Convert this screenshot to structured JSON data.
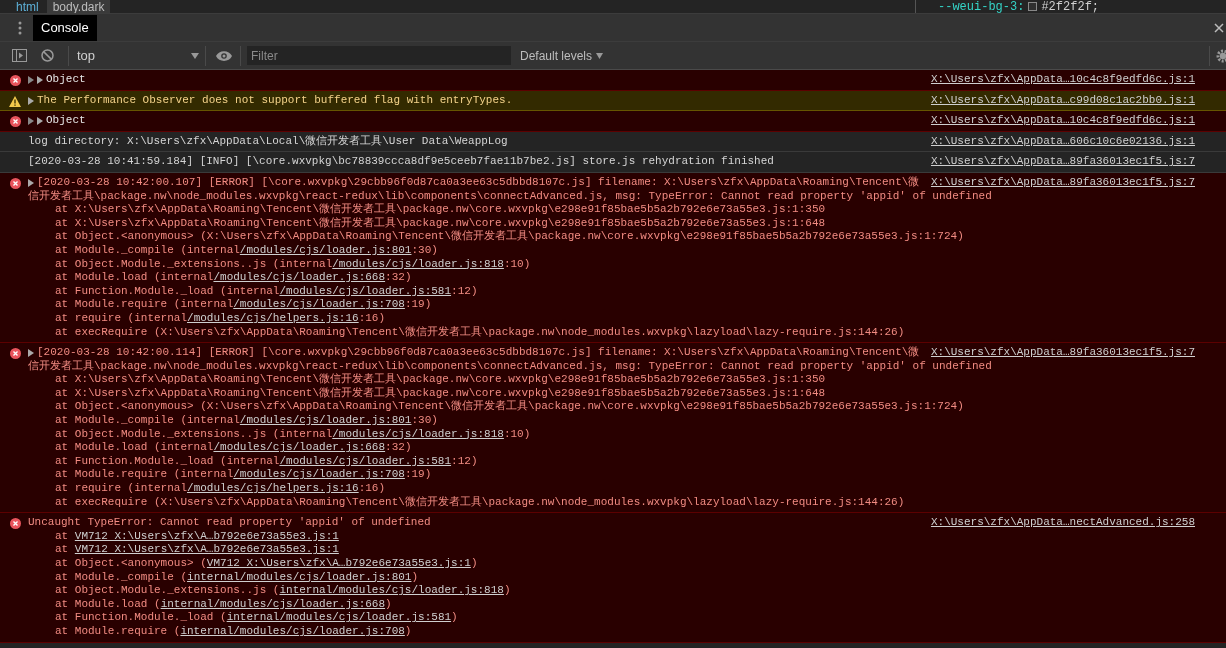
{
  "breadcrumb": [
    {
      "label": "html",
      "selected": false
    },
    {
      "label": "body.dark",
      "selected": true
    }
  ],
  "styles_pane": {
    "property": "--weui-bg-3:",
    "value": "#2f2f2f;"
  },
  "tabs": [
    {
      "label": "Console",
      "selected": true
    }
  ],
  "toolbar": {
    "context": "top",
    "filter_placeholder": "Filter",
    "levels": "Default levels"
  },
  "rows": [
    {
      "kind": "error",
      "grouped": true,
      "expandable": true,
      "message": "Object",
      "source": "X:\\Users\\zfx\\AppData…10c4c8f9edfd6c.js:1"
    },
    {
      "kind": "warning",
      "grouped": false,
      "expandable": true,
      "message": "The Performance Observer does not support buffered flag with entryTypes.",
      "source": "X:\\Users\\zfx\\AppData…c99d08c1ac2bb0.js:1"
    },
    {
      "kind": "error",
      "grouped": true,
      "expandable": true,
      "message": "Object",
      "source": "X:\\Users\\zfx\\AppData…10c4c8f9edfd6c.js:1"
    },
    {
      "kind": "info",
      "grouped": false,
      "expandable": false,
      "message": "log directory: X:\\Users\\zfx\\AppData\\Local\\微信开发者工具\\User Data\\WeappLog",
      "source": "X:\\Users\\zfx\\AppData…606c10c6e02136.js:1"
    },
    {
      "kind": "info",
      "grouped": false,
      "expandable": false,
      "message": "[2020-03-28 10:41:59.184] [INFO] [\\core.wxvpkg\\bc78839ccca8df9e5ceeb7fae11b7be2.js] store.js rehydration finished",
      "source": "X:\\Users\\zfx\\AppData…89fa36013ec1f5.js:7"
    },
    {
      "kind": "error",
      "grouped": false,
      "expandable": true,
      "message": "[2020-03-28 10:42:00.107] [ERROR] [\\core.wxvpkg\\29cbb96f0d87ca0a3ee63c5dbbd8107c.js] filename: X:\\Users\\zfx\\AppData\\Roaming\\Tencent\\微",
      "message_continued": "信开发者工具\\package.nw\\node_modules.wxvpkg\\react-redux\\lib\\components\\connectAdvanced.js, msg: TypeError: Cannot read property 'appid' of undefined",
      "source": "X:\\Users\\zfx\\AppData…89fa36013ec1f5.js:7",
      "stack": [
        [
          "at X:\\Users\\zfx\\AppData\\Roaming\\Tencent\\微信开发者工具\\package.nw\\core.wxvpkg\\e298e91f85bae5b5a2b792e6e73a55e3.js:1:350"
        ],
        [
          "at X:\\Users\\zfx\\AppData\\Roaming\\Tencent\\微信开发者工具\\package.nw\\core.wxvpkg\\e298e91f85bae5b5a2b792e6e73a55e3.js:1:648"
        ],
        [
          "at Object.<anonymous> (X:\\Users\\zfx\\AppData\\Roaming\\Tencent\\微信开发者工具\\package.nw\\core.wxvpkg\\e298e91f85bae5b5a2b792e6e73a55e3.js:1:724)"
        ],
        [
          "at Module._compile (internal",
          "/modules/cjs/loader.js:801",
          ":30)"
        ],
        [
          "at Object.Module._extensions..js (internal",
          "/modules/cjs/loader.js:818",
          ":10)"
        ],
        [
          "at Module.load (internal",
          "/modules/cjs/loader.js:668",
          ":32)"
        ],
        [
          "at Function.Module._load (internal",
          "/modules/cjs/loader.js:581",
          ":12)"
        ],
        [
          "at Module.require (internal",
          "/modules/cjs/loader.js:708",
          ":19)"
        ],
        [
          "at require (internal",
          "/modules/cjs/helpers.js:16",
          ":16)"
        ],
        [
          "at execRequire (X:\\Users\\zfx\\AppData\\Roaming\\Tencent\\微信开发者工具\\package.nw\\node_modules.wxvpkg\\lazyload\\lazy-require.js:144:26)"
        ]
      ]
    },
    {
      "kind": "error",
      "grouped": false,
      "expandable": true,
      "message": "[2020-03-28 10:42:00.114] [ERROR] [\\core.wxvpkg\\29cbb96f0d87ca0a3ee63c5dbbd8107c.js] filename: X:\\Users\\zfx\\AppData\\Roaming\\Tencent\\微",
      "message_continued": "信开发者工具\\package.nw\\node_modules.wxvpkg\\react-redux\\lib\\components\\connectAdvanced.js, msg: TypeError: Cannot read property 'appid' of undefined",
      "source": "X:\\Users\\zfx\\AppData…89fa36013ec1f5.js:7",
      "stack": [
        [
          "at X:\\Users\\zfx\\AppData\\Roaming\\Tencent\\微信开发者工具\\package.nw\\core.wxvpkg\\e298e91f85bae5b5a2b792e6e73a55e3.js:1:350"
        ],
        [
          "at X:\\Users\\zfx\\AppData\\Roaming\\Tencent\\微信开发者工具\\package.nw\\core.wxvpkg\\e298e91f85bae5b5a2b792e6e73a55e3.js:1:648"
        ],
        [
          "at Object.<anonymous> (X:\\Users\\zfx\\AppData\\Roaming\\Tencent\\微信开发者工具\\package.nw\\core.wxvpkg\\e298e91f85bae5b5a2b792e6e73a55e3.js:1:724)"
        ],
        [
          "at Module._compile (internal",
          "/modules/cjs/loader.js:801",
          ":30)"
        ],
        [
          "at Object.Module._extensions..js (internal",
          "/modules/cjs/loader.js:818",
          ":10)"
        ],
        [
          "at Module.load (internal",
          "/modules/cjs/loader.js:668",
          ":32)"
        ],
        [
          "at Function.Module._load (internal",
          "/modules/cjs/loader.js:581",
          ":12)"
        ],
        [
          "at Module.require (internal",
          "/modules/cjs/loader.js:708",
          ":19)"
        ],
        [
          "at require (internal",
          "/modules/cjs/helpers.js:16",
          ":16)"
        ],
        [
          "at execRequire (X:\\Users\\zfx\\AppData\\Roaming\\Tencent\\微信开发者工具\\package.nw\\node_modules.wxvpkg\\lazyload\\lazy-require.js:144:26)"
        ]
      ]
    },
    {
      "kind": "error",
      "grouped": false,
      "expandable": false,
      "message": "Uncaught TypeError: Cannot read property 'appid' of undefined",
      "source": "X:\\Users\\zfx\\AppData…nectAdvanced.js:258",
      "stack": [
        [
          "at ",
          "VM712 X:\\Users\\zfx\\A…b792e6e73a55e3.js:1"
        ],
        [
          "at ",
          "VM712 X:\\Users\\zfx\\A…b792e6e73a55e3.js:1"
        ],
        [
          "at Object.<anonymous> (",
          "VM712 X:\\Users\\zfx\\A…b792e6e73a55e3.js:1",
          ")"
        ],
        [
          "at Module._compile (",
          "internal/modules/cjs/loader.js:801",
          ")"
        ],
        [
          "at Object.Module._extensions..js (",
          "internal/modules/cjs/loader.js:818",
          ")"
        ],
        [
          "at Module.load (",
          "internal/modules/cjs/loader.js:668",
          ")"
        ],
        [
          "at Function.Module._load (",
          "internal/modules/cjs/loader.js:581",
          ")"
        ],
        [
          "at Module.require (",
          "internal/modules/cjs/loader.js:708",
          ")"
        ]
      ]
    }
  ]
}
